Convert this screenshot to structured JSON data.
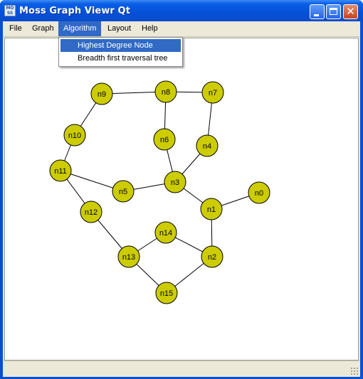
{
  "window": {
    "title": "Moss Graph Viewr Qt",
    "icon_text": "MOSS"
  },
  "menubar": {
    "items": [
      "File",
      "Graph",
      "Algorithm",
      "Layout",
      "Help"
    ],
    "active": "Algorithm"
  },
  "algorithm_menu": {
    "items": [
      "Highest Degree Node",
      "Breadth first traversal tree"
    ],
    "highlighted": "Highest Degree Node"
  },
  "graph": {
    "node_color": "#cccc00",
    "edge_color": "#000000",
    "nodes": [
      {
        "id": "n0"
      },
      {
        "id": "n1"
      },
      {
        "id": "n2"
      },
      {
        "id": "n3"
      },
      {
        "id": "n4"
      },
      {
        "id": "n5"
      },
      {
        "id": "n6"
      },
      {
        "id": "n7"
      },
      {
        "id": "n8"
      },
      {
        "id": "n9"
      },
      {
        "id": "n10"
      },
      {
        "id": "n11"
      },
      {
        "id": "n12"
      },
      {
        "id": "n13"
      },
      {
        "id": "n14"
      },
      {
        "id": "n15"
      }
    ],
    "edges": [
      [
        "n9",
        "n8"
      ],
      [
        "n8",
        "n7"
      ],
      [
        "n9",
        "n10"
      ],
      [
        "n8",
        "n6"
      ],
      [
        "n7",
        "n4"
      ],
      [
        "n10",
        "n11"
      ],
      [
        "n6",
        "n3"
      ],
      [
        "n4",
        "n3"
      ],
      [
        "n11",
        "n5"
      ],
      [
        "n5",
        "n3"
      ],
      [
        "n11",
        "n12"
      ],
      [
        "n3",
        "n1"
      ],
      [
        "n1",
        "n0"
      ],
      [
        "n1",
        "n2"
      ],
      [
        "n12",
        "n13"
      ],
      [
        "n13",
        "n14"
      ],
      [
        "n14",
        "n2"
      ],
      [
        "n13",
        "n15"
      ],
      [
        "n15",
        "n2"
      ]
    ]
  }
}
